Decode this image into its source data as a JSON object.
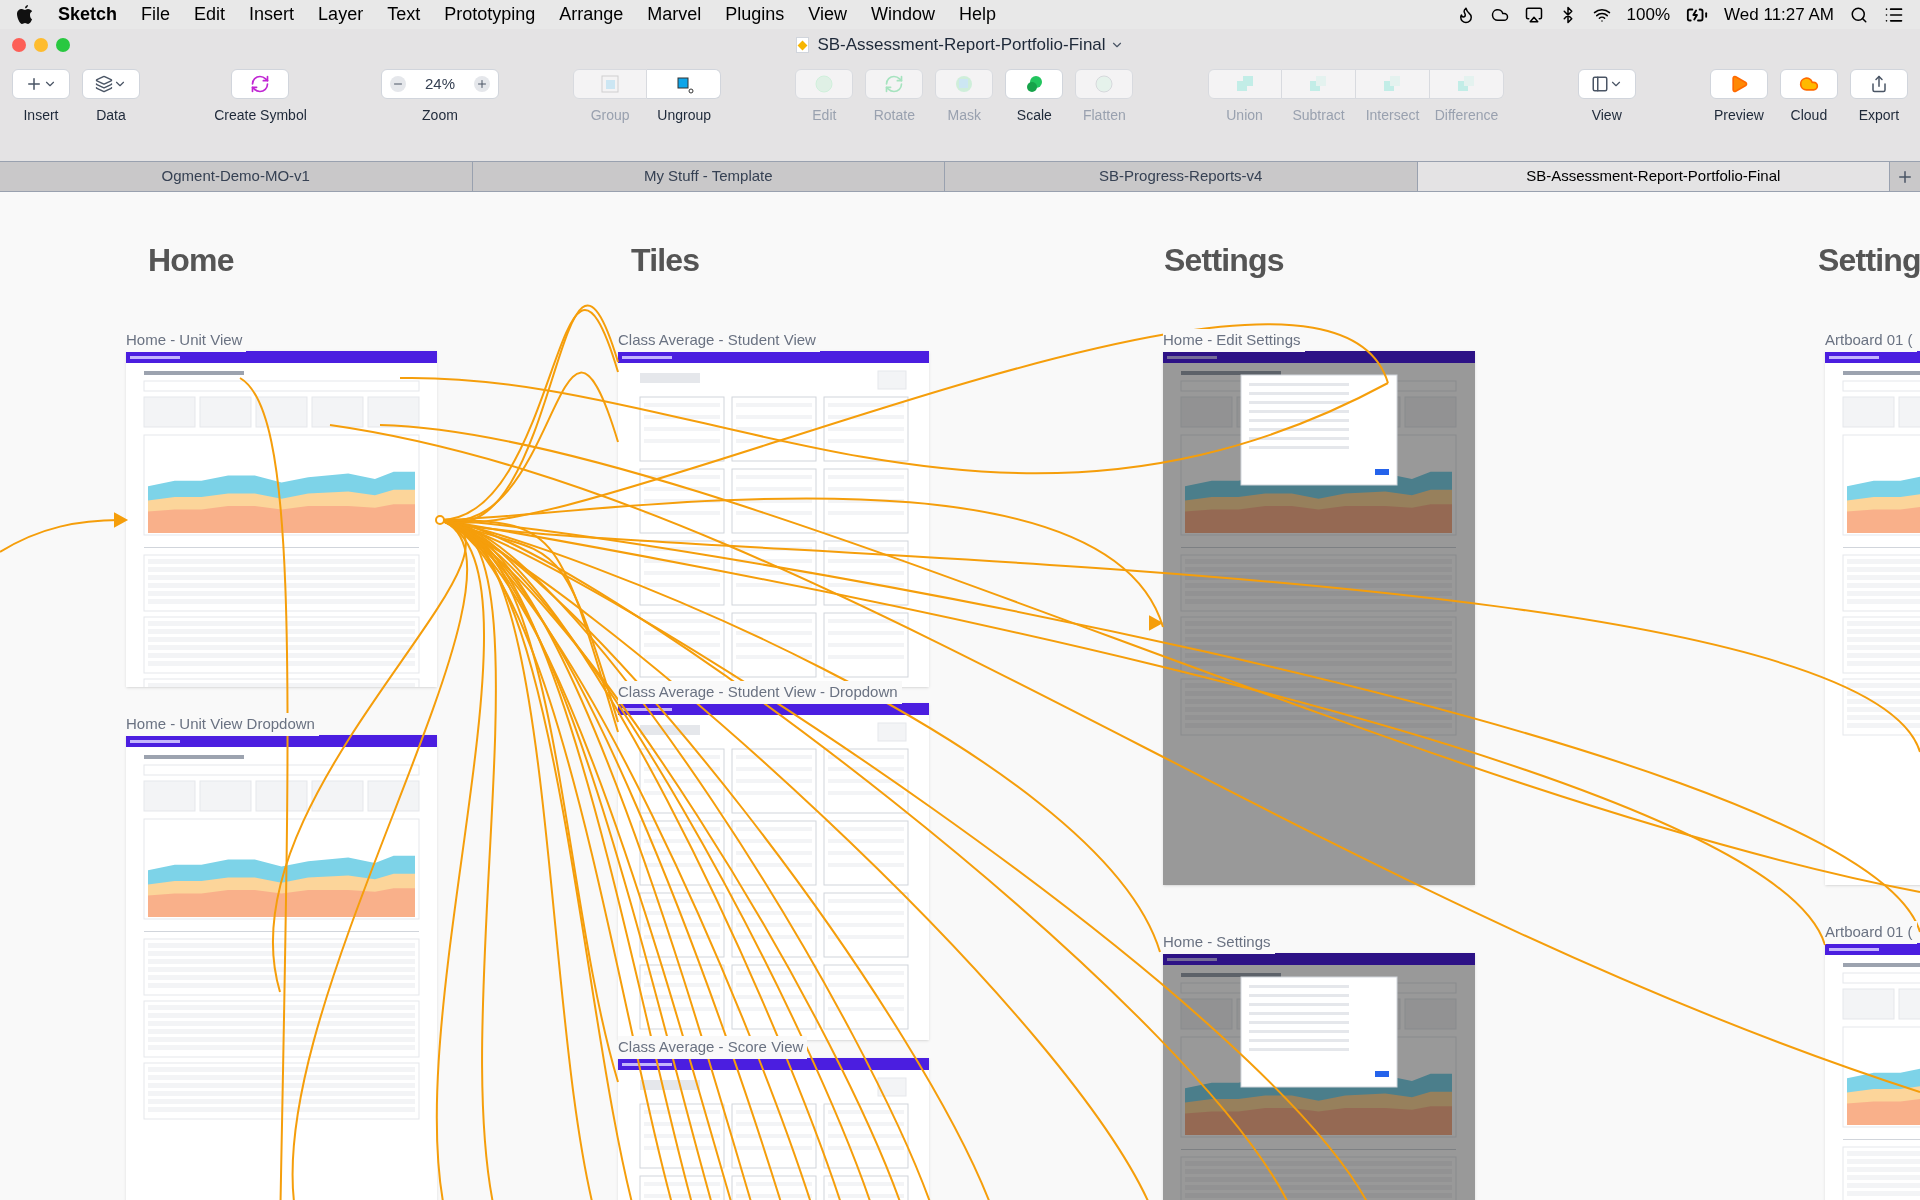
{
  "menu_bar": {
    "app": "Sketch",
    "items": [
      "File",
      "Edit",
      "Insert",
      "Layer",
      "Text",
      "Prototyping",
      "Arrange",
      "Marvel",
      "Plugins",
      "View",
      "Window",
      "Help"
    ],
    "battery": "100%",
    "clock": "Wed 11:27 AM"
  },
  "window": {
    "title": "SB-Assessment-Report-Portfolio-Final"
  },
  "toolbar": {
    "groups": [
      {
        "kind": "separate",
        "items": [
          {
            "label": "Insert",
            "kind": "insert",
            "disabled": false
          },
          {
            "label": "Data",
            "kind": "data",
            "disabled": false
          }
        ]
      },
      {
        "kind": "separate",
        "items": [
          {
            "label": "Create Symbol",
            "kind": "symbol",
            "disabled": false
          }
        ]
      },
      {
        "kind": "separate",
        "items": [
          {
            "label": "Zoom",
            "kind": "zoom",
            "value": "24%",
            "disabled": false
          }
        ]
      },
      {
        "kind": "segmented",
        "items": [
          {
            "label": "Group",
            "kind": "group",
            "disabled": true
          },
          {
            "label": "Ungroup",
            "kind": "ungroup",
            "disabled": false
          }
        ]
      },
      {
        "kind": "separate",
        "items": [
          {
            "label": "Edit",
            "kind": "edit",
            "disabled": true
          },
          {
            "label": "Rotate",
            "kind": "rotate",
            "disabled": true
          },
          {
            "label": "Mask",
            "kind": "mask",
            "disabled": true
          },
          {
            "label": "Scale",
            "kind": "scale",
            "disabled": false
          },
          {
            "label": "Flatten",
            "kind": "flatten",
            "disabled": true
          }
        ]
      },
      {
        "kind": "segmented",
        "items": [
          {
            "label": "Union",
            "kind": "union",
            "disabled": true
          },
          {
            "label": "Subtract",
            "kind": "subtract",
            "disabled": true
          },
          {
            "label": "Intersect",
            "kind": "intersect",
            "disabled": true
          },
          {
            "label": "Difference",
            "kind": "difference",
            "disabled": true
          }
        ]
      },
      {
        "kind": "separate",
        "items": [
          {
            "label": "View",
            "kind": "view",
            "disabled": false
          }
        ]
      },
      {
        "kind": "separate",
        "items": [
          {
            "label": "Preview",
            "kind": "preview",
            "disabled": false
          },
          {
            "label": "Cloud",
            "kind": "cloud",
            "disabled": false
          },
          {
            "label": "Export",
            "kind": "export",
            "disabled": false
          }
        ]
      }
    ]
  },
  "document_tabs": [
    {
      "label": "Ogment-Demo-MO-v1",
      "selected": false
    },
    {
      "label": "My Stuff - Template",
      "selected": false
    },
    {
      "label": "SB-Progress-Reports-v4",
      "selected": false
    },
    {
      "label": "SB-Assessment-Report-Portfolio-Final",
      "selected": true
    }
  ],
  "canvas": {
    "sections": [
      "Home",
      "Tiles",
      "Settings",
      "Setting"
    ],
    "artboards": [
      {
        "label": "Home - Unit View",
        "kind": "home",
        "dimmed": false
      },
      {
        "label": "Home - Unit View Dropdown",
        "kind": "home",
        "dimmed": false
      },
      {
        "label": "Class Average - Student View",
        "kind": "tiles",
        "dimmed": false
      },
      {
        "label": "Class Average - Student View - Dropdown",
        "kind": "tiles",
        "dimmed": false
      },
      {
        "label": "Class Average - Score View",
        "kind": "tiles",
        "dimmed": false
      },
      {
        "label": "Home - Edit Settings",
        "kind": "settings",
        "dimmed": true
      },
      {
        "label": "Home - Settings",
        "kind": "settings",
        "dimmed": true
      },
      {
        "label": "Artboard 01 (",
        "kind": "home",
        "dimmed": false
      },
      {
        "label": "Artboard 01 (",
        "kind": "home",
        "dimmed": false
      }
    ]
  }
}
